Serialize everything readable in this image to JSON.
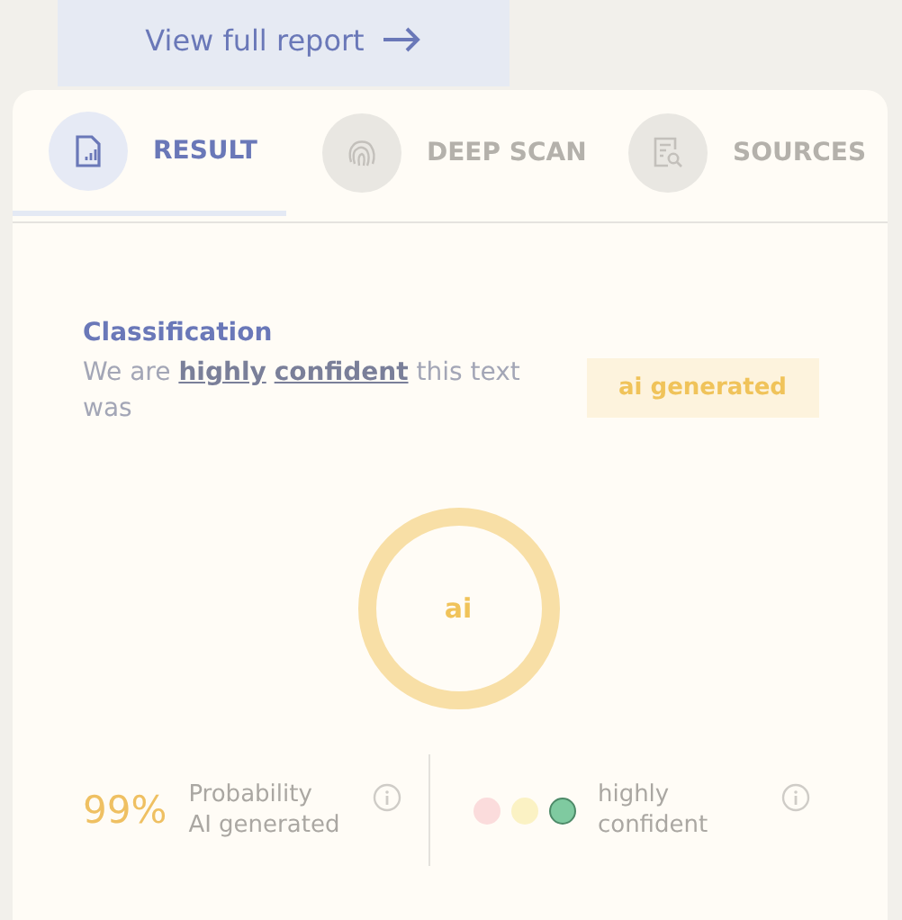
{
  "report_button": {
    "label": "View full report"
  },
  "tabs": [
    {
      "label": "RESULT",
      "kind": "result",
      "selected": true
    },
    {
      "label": "DEEP SCAN",
      "kind": "scan",
      "selected": false
    },
    {
      "label": "SOURCES",
      "kind": "sources",
      "selected": false
    }
  ],
  "classification": {
    "title": "Classification",
    "sentence": "We are **highly** **confident** this text was",
    "verdict": "ai generated",
    "donut_label": "ai"
  },
  "probability": {
    "value": "99%",
    "label_lines": [
      "Probability",
      "AI generated"
    ]
  },
  "confidence": {
    "dots": [
      {
        "color": "#fbdcdc",
        "selected": false
      },
      {
        "color": "#fbf2c4",
        "selected": false
      },
      {
        "color": "#7fcaa0",
        "selected": true
      }
    ],
    "label_lines": [
      "highly",
      "confident"
    ]
  }
}
